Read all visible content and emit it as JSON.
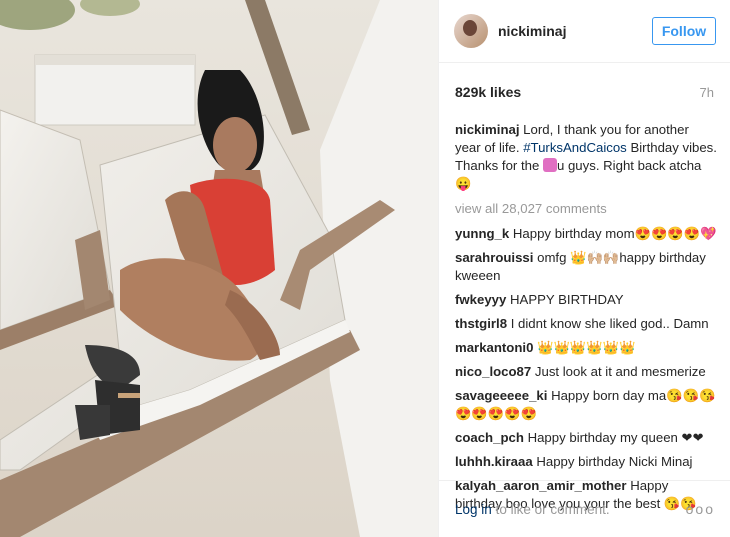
{
  "post": {
    "username": "nickiminaj",
    "follow_label": "Follow",
    "likes": "829k likes",
    "time": "7h",
    "caption_user": "nickiminaj",
    "caption_part1": "Lord, I thank you for another year of life.",
    "caption_hashtag": "#TurksAndCaicos",
    "caption_part2": "Birthday vibes. Thanks for the",
    "caption_part3": "u guys. Right back atcha😛",
    "view_all": "view all 28,027 comments",
    "comments": [
      {
        "user": "yunng_k",
        "text": "Happy birthday mom😍😍😍😍💖"
      },
      {
        "user": "sarahrouissi",
        "text": "omfg 👑🙌🏼🙌🏼happy birthday kweeen"
      },
      {
        "user": "fwkeyyy",
        "text": "HAPPY BIRTHDAY"
      },
      {
        "user": "thstgirl8",
        "text": "I didnt know she liked god.. Damn"
      },
      {
        "user": "markantoni0",
        "text": "👑👑👑👑👑👑"
      },
      {
        "user": "nico_loco87",
        "text": "Just look at it and mesmerize"
      },
      {
        "user": "savageeeee_ki",
        "text": "Happy born day ma😘😘😘😍😍😍😍😍"
      },
      {
        "user": "coach_pch",
        "text": "Happy birthday my queen ❤❤"
      },
      {
        "user": "luhhh.kiraaa",
        "text": "Happy birthday Nicki Minaj"
      },
      {
        "user": "kalyah_aaron_amir_mother",
        "text": "Happy birthday boo love you your the best 😘😘"
      }
    ],
    "login_link": "Log in",
    "login_rest": "to like or comment.",
    "more_icon": "more-options-icon",
    "more_glyph": "ooo"
  }
}
